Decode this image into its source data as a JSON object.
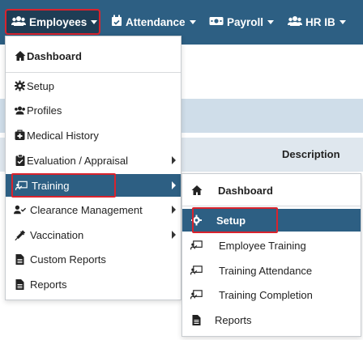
{
  "navbar": {
    "items": [
      {
        "label": "Employees",
        "icon": "users-icon"
      },
      {
        "label": "Attendance",
        "icon": "calendar-check-icon"
      },
      {
        "label": "Payroll",
        "icon": "money-bill-icon"
      },
      {
        "label": "HR IB",
        "icon": "users-icon"
      }
    ]
  },
  "background": {
    "column_header": "Description"
  },
  "employees_menu": {
    "items": [
      {
        "label": "Dashboard",
        "icon": "home-icon"
      },
      {
        "label": "Setup",
        "icon": "gear-icon"
      },
      {
        "label": "Profiles",
        "icon": "users-icon"
      },
      {
        "label": "Medical History",
        "icon": "medical-kit-icon"
      },
      {
        "label": "Evaluation / Appraisal",
        "icon": "clipboard-check-icon"
      },
      {
        "label": "Training",
        "icon": "chalkboard-teacher-icon"
      },
      {
        "label": "Clearance Management",
        "icon": "user-check-icon"
      },
      {
        "label": "Vaccination",
        "icon": "syringe-icon"
      },
      {
        "label": "Custom Reports",
        "icon": "file-icon"
      },
      {
        "label": "Reports",
        "icon": "file-icon"
      }
    ]
  },
  "training_submenu": {
    "items": [
      {
        "label": "Dashboard",
        "icon": "home-icon"
      },
      {
        "label": "Setup",
        "icon": "gear-icon"
      },
      {
        "label": "Employee Training",
        "icon": "chalkboard-teacher-icon"
      },
      {
        "label": "Training Attendance",
        "icon": "chalkboard-teacher-icon"
      },
      {
        "label": "Training Completion",
        "icon": "chalkboard-teacher-icon"
      },
      {
        "label": "Reports",
        "icon": "file-icon"
      }
    ]
  },
  "colors": {
    "navbar": "#2d5f83",
    "active_item": "#2d5f83",
    "highlight_border": "#d9232d"
  }
}
